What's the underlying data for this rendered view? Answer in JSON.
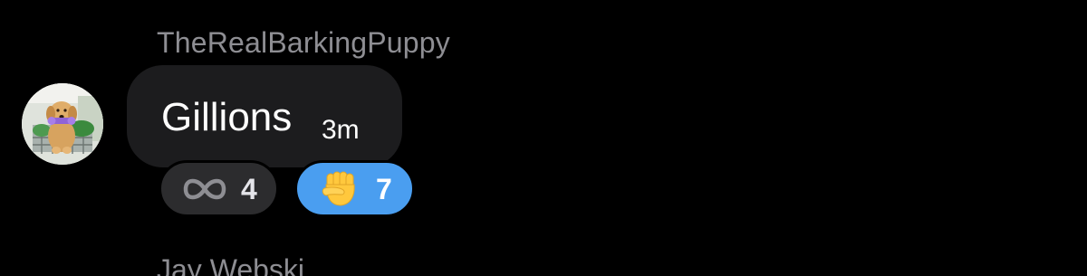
{
  "message": {
    "sender": "TheRealBarkingPuppy",
    "text": "Gillions",
    "time": "3m",
    "bubble_color": "#1c1c1e"
  },
  "avatar": {
    "icon": "puppy-photo"
  },
  "reactions": [
    {
      "icon": "infinity-icon",
      "count": "4",
      "color": "#2c2c2e"
    },
    {
      "icon": "raised-fist-emoji",
      "count": "7",
      "color": "#4a9ef0"
    }
  ],
  "next_message": {
    "sender": "Jay Webski"
  },
  "theme": {
    "background": "#000000",
    "secondary_text": "#8e8e93",
    "primary_text": "#ffffff"
  }
}
